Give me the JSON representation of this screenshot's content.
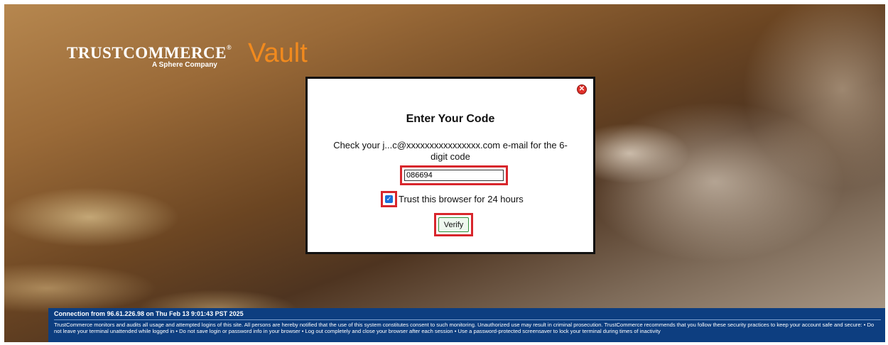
{
  "brand": {
    "name": "TRUSTCOMMERCE",
    "registered": "®",
    "tagline": "A Sphere Company",
    "product": "Vault",
    "product_color": "#f18a1e"
  },
  "modal": {
    "close_icon": "close-circle-icon",
    "title": "Enter Your Code",
    "message": "Check your j...c@xxxxxxxxxxxxxxxx.com e-mail for the 6-digit code",
    "code_value": "086694",
    "trust_checked": true,
    "trust_label": "Trust this browser for 24 hours",
    "verify_label": "Verify",
    "highlight_color": "#d8262c"
  },
  "footer": {
    "connection": "Connection from 96.61.226.98 on Thu Feb 13 9:01:43 PST 2025",
    "notice": "TrustCommerce monitors and audits all usage and attempted logins of this site. All persons are hereby notified that the use of this system constitutes consent to such monitoring. Unauthorized use may result in criminal prosecution. TrustCommerce recommends that you follow these security practices to keep your account safe and secure: • Do not leave your terminal unattended while logged in • Do not save login or password info in your browser • Log out completely and close your browser after each session • Use a password-protected screensaver to lock your terminal during times of inactivity",
    "background": "#0d3e80"
  }
}
